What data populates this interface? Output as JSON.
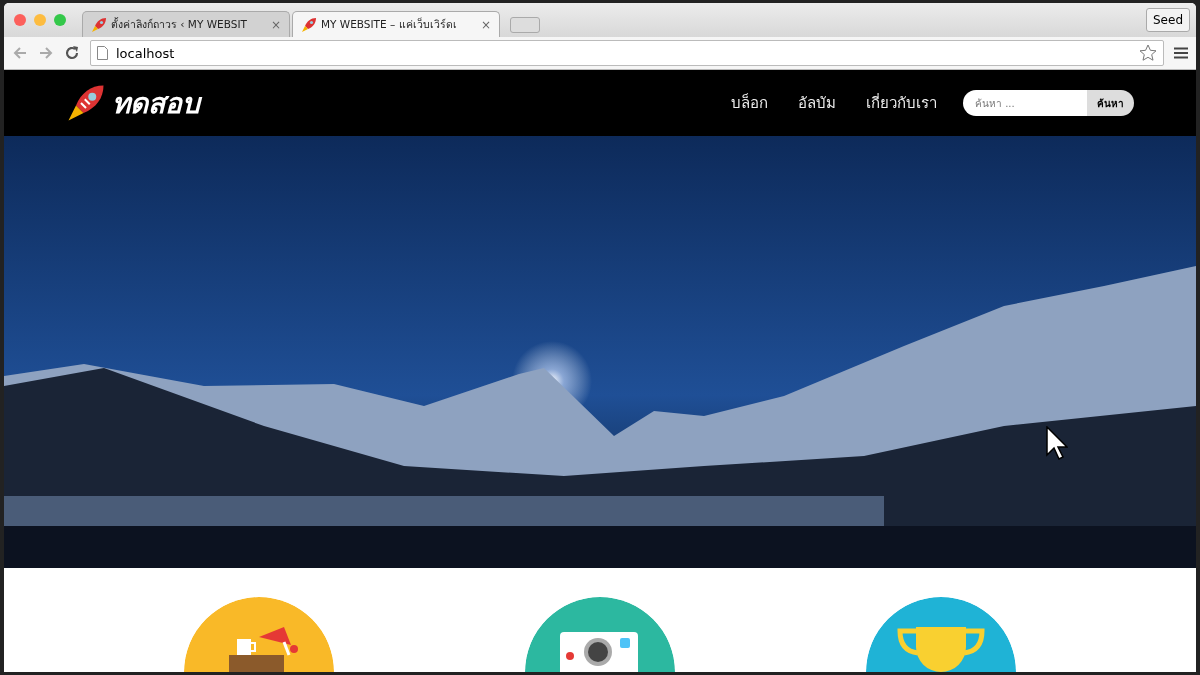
{
  "browser": {
    "tabs": [
      {
        "title": "ตั้งค่าลิงก์ถาวร ‹ MY WEBSIT",
        "close": "×",
        "selected": false
      },
      {
        "title": "MY WEBSITE – แค่เว็บเวิร์ดเ",
        "close": "×",
        "selected": true
      }
    ],
    "profile": "Seed",
    "address": "localhost"
  },
  "site": {
    "logo": "ทดสอบ",
    "nav": [
      {
        "label": "บล็อก"
      },
      {
        "label": "อัลบัม"
      },
      {
        "label": "เกี่ยวกับเรา"
      }
    ],
    "search": {
      "placeholder": "ค้นหา ...",
      "button": "ค้นหา"
    },
    "features": [
      {
        "kind": "desk",
        "color": "#f9b928"
      },
      {
        "kind": "camera",
        "color": "#2cb8a0"
      },
      {
        "kind": "trophy",
        "color": "#1fb3d6"
      }
    ]
  }
}
